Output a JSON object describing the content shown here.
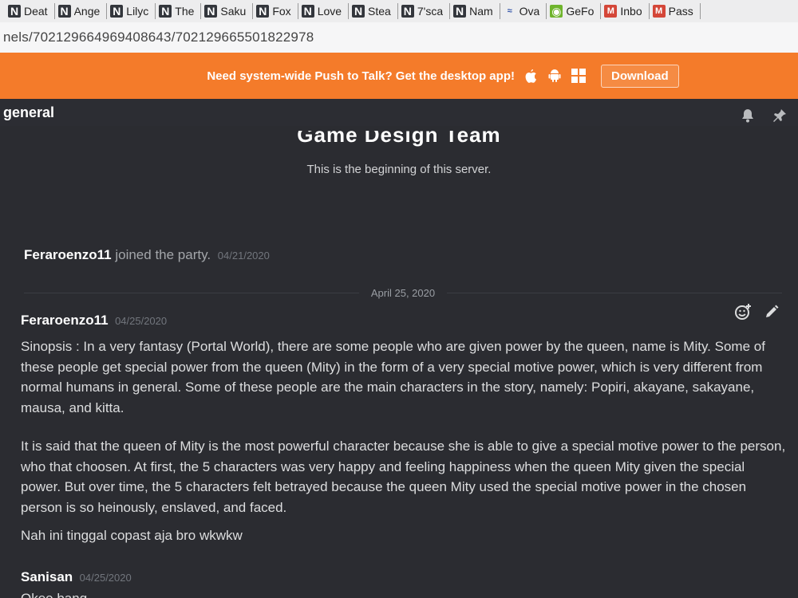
{
  "bookmarks": [
    {
      "label": "Deat",
      "icon": "n-icon"
    },
    {
      "label": "Ange",
      "icon": "n-icon"
    },
    {
      "label": "Lilyc",
      "icon": "n-icon"
    },
    {
      "label": "The",
      "icon": "n-icon"
    },
    {
      "label": "Saku",
      "icon": "n-icon"
    },
    {
      "label": "Fox",
      "icon": "n-icon"
    },
    {
      "label": "Love",
      "icon": "n-icon"
    },
    {
      "label": "Stea",
      "icon": "n-icon"
    },
    {
      "label": "7'sca",
      "icon": "n-icon"
    },
    {
      "label": "Nam",
      "icon": "n-icon"
    },
    {
      "label": "Ova",
      "icon": "ova-icon"
    },
    {
      "label": "GeFo",
      "icon": "nvidia-icon"
    },
    {
      "label": "Inbo",
      "icon": "gmail-icon"
    },
    {
      "label": "Pass",
      "icon": "gmail-icon"
    }
  ],
  "url": "nels/702129664969408643/702129665501822978",
  "notice": {
    "text": "Need system-wide Push to Talk? Get the desktop app!",
    "download_label": "Download",
    "color": "#f47b2a"
  },
  "channel": {
    "name": "general"
  },
  "server": {
    "title": "Game Design Team",
    "subtitle": "This is the beginning of this server."
  },
  "system_message": {
    "user": "Feraroenzo11",
    "text": "joined the party.",
    "timestamp": "04/21/2020"
  },
  "date_divider": "April 25, 2020",
  "messages": [
    {
      "author": "Feraroenzo11",
      "timestamp": "04/25/2020",
      "paragraphs": [
        "Sinopsis : In a very fantasy (Portal World), there are some people who are given power by the queen, name is Mity. Some of these people get special power from the queen (Mity) in the form of a very special motive power, which is very different from normal humans in general. Some of these people are the main characters in the story, namely: Popiri, akayane, sakayane, mausa, and kitta.",
        "It is said that the queen of Mity is the most powerful character because she is able to give a special motive power to the person, who that choosen. At first, the 5 characters was very happy and feeling happiness when the queen Mity given the special power. But over time, the 5 characters felt betrayed because the queen Mity used the special motive power in the chosen person is so heinously, enslaved, and faced.",
        "Nah ini tinggal copast aja bro wkwkw"
      ]
    },
    {
      "author": "Sanisan",
      "timestamp": "04/25/2020",
      "paragraphs": [
        "Okee bang"
      ]
    }
  ]
}
